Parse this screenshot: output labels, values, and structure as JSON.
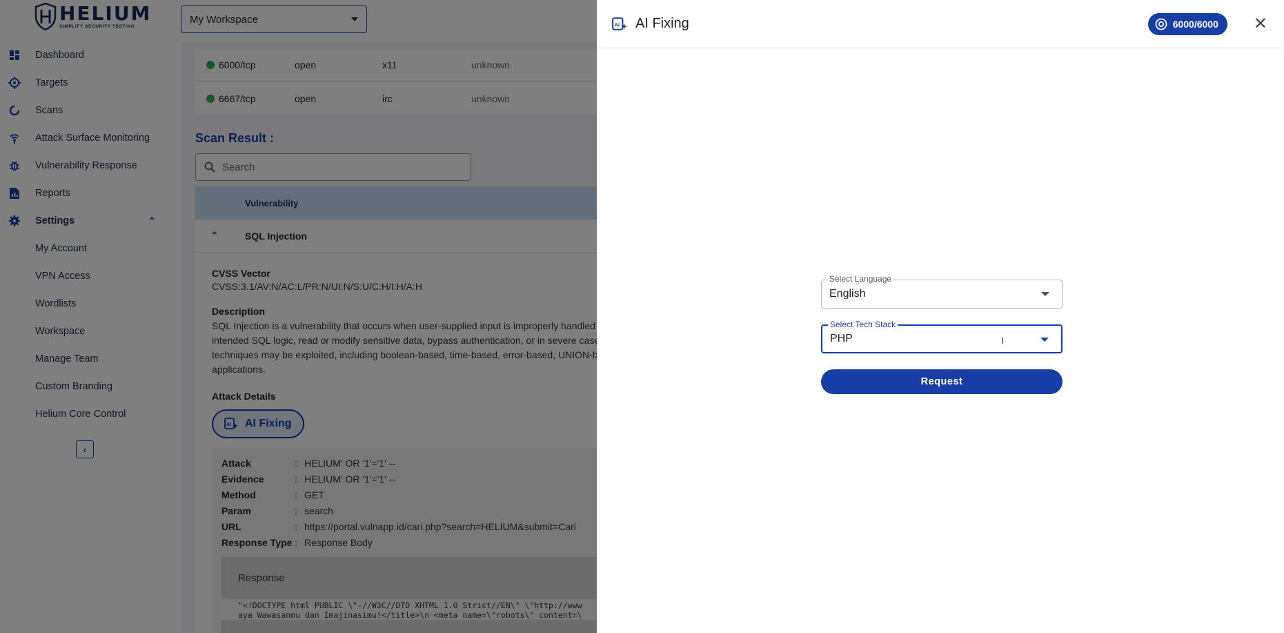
{
  "brand": {
    "name": "HELIUM",
    "tagline": "SIMPLIFY SECURITY TESTING"
  },
  "workspace": {
    "selected": "My Workspace"
  },
  "sidebar": {
    "items": [
      {
        "label": "Dashboard",
        "icon": "dashboard-icon"
      },
      {
        "label": "Targets",
        "icon": "target-icon"
      },
      {
        "label": "Scans",
        "icon": "scan-icon"
      },
      {
        "label": "Attack Surface Monitoring",
        "icon": "broadcast-icon"
      },
      {
        "label": "Vulnerability Response",
        "icon": "bug-icon"
      },
      {
        "label": "Reports",
        "icon": "report-icon"
      }
    ],
    "settings": {
      "label": "Settings",
      "icon": "gear-icon",
      "expanded": true,
      "sub_items": [
        "My Account",
        "VPN Access",
        "Wordlists",
        "Workspace",
        "Manage Team",
        "Custom Branding",
        "Helium Core Control"
      ]
    }
  },
  "ports": [
    {
      "port": "6000/tcp",
      "state": "open",
      "service": "x11",
      "version": "unknown"
    },
    {
      "port": "6667/tcp",
      "state": "open",
      "service": "irc",
      "version": "unknown"
    }
  ],
  "scan_result": {
    "title": "Scan Result :",
    "search_placeholder": "Search",
    "column_header": "Vulnerability",
    "vuln_name": "SQL Injection",
    "cvss_label": "CVSS Vector",
    "cvss_value": "CVSS:3.1/AV:N/AC:L/PR:N/UI:N/S:U/C:H/I:H/A:H",
    "description_label": "Description",
    "description_lines": [
      "SQL Injection is a vulnerability that occurs when user-supplied input is improperly handled",
      "intended SQL logic, read or modify sensitive data, bypass authentication, or in severe case",
      "techniques may be exploited, including boolean-based, time-based, error-based, UNION-ba",
      "applications."
    ],
    "attack_details_label": "Attack Details",
    "ai_fixing_label": "AI Fixing",
    "attack_details": [
      {
        "key": "Attack",
        "value": "HELIUM' OR '1'='1' --"
      },
      {
        "key": "Evidence",
        "value": "HELIUM' OR '1'='1' --"
      },
      {
        "key": "Method",
        "value": "GET"
      },
      {
        "key": "Param",
        "value": "search"
      },
      {
        "key": "URL",
        "value": "https://portal.vulnapp.id/cari.php?search=HELIUM&submit=Cari"
      },
      {
        "key": "Response Type",
        "value": "Response Body"
      }
    ],
    "response_label": "Response",
    "response_lines": [
      "\"<!DOCTYPE html PUBLIC \\\"-//W3C//DTD XHTML 1.0 Strict//EN\\\" \\\"http://www",
      "aya Wawasanmu dan Imajinasimu!</title>\\n <meta name=\\\"robots\\\" content=\\"
    ]
  },
  "drawer": {
    "title": "AI Fixing",
    "quota": "6000/6000",
    "language_label": "Select Language",
    "language_value": "English",
    "tech_label": "Select Tech Stack",
    "tech_value": "PHP",
    "request_label": "Request"
  }
}
